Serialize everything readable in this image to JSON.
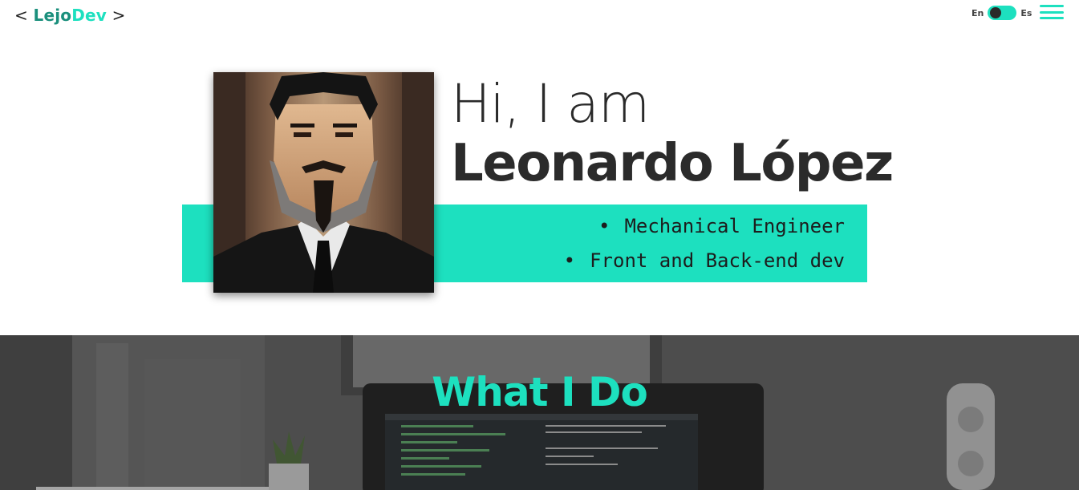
{
  "header": {
    "logo": {
      "open": "< ",
      "name_a": "Lejo",
      "name_b": "Dev",
      "close": " >"
    },
    "lang": {
      "left": "En",
      "right": "Es"
    },
    "menu_icon": "hamburger-menu-icon"
  },
  "hero": {
    "greeting": "Hi, I am",
    "name": "Leonardo López",
    "roles": [
      "Mechanical Engineer",
      "Front and Back-end dev"
    ],
    "bullet": "•"
  },
  "section": {
    "title": "What I Do"
  },
  "colors": {
    "accent": "#1de0bf",
    "text_dark": "#2b2b2b",
    "section_bg": "#5b5b5b"
  }
}
